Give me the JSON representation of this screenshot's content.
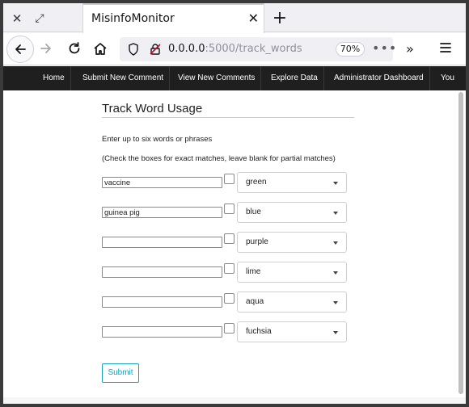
{
  "browser": {
    "tab_title": "MisinfoMonitor",
    "url_host": "0.0.0.0",
    "url_rest": ":5000/track_words",
    "zoom": "70%"
  },
  "site_nav": {
    "items": [
      {
        "label": "Home"
      },
      {
        "label": "Submit New Comment"
      },
      {
        "label": "View New Comments"
      },
      {
        "label": "Explore Data"
      },
      {
        "label": "Administrator Dashboard"
      },
      {
        "label": "You"
      }
    ]
  },
  "form": {
    "title": "Track Word Usage",
    "instruction1": "Enter up to six words or phrases",
    "instruction2": "(Check the boxes for exact matches, leave blank for partial matches)",
    "rows": [
      {
        "word": "vaccine",
        "exact": false,
        "color": "green"
      },
      {
        "word": "guinea pig",
        "exact": false,
        "color": "blue"
      },
      {
        "word": "",
        "exact": false,
        "color": "purple"
      },
      {
        "word": "",
        "exact": false,
        "color": "lime"
      },
      {
        "word": "",
        "exact": false,
        "color": "aqua"
      },
      {
        "word": "",
        "exact": false,
        "color": "fuchsia"
      }
    ],
    "submit_label": "Submit"
  },
  "colors": {
    "accent": "#17a2b8",
    "nav_bg": "#1f1f1f"
  }
}
